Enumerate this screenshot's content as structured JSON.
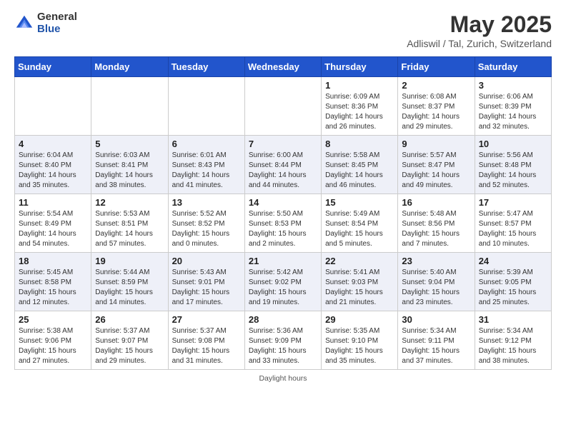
{
  "logo": {
    "general": "General",
    "blue": "Blue"
  },
  "title": "May 2025",
  "subtitle": "Adliswil / Tal, Zurich, Switzerland",
  "days_of_week": [
    "Sunday",
    "Monday",
    "Tuesday",
    "Wednesday",
    "Thursday",
    "Friday",
    "Saturday"
  ],
  "footer": "Daylight hours",
  "weeks": [
    [
      {
        "num": "",
        "info": ""
      },
      {
        "num": "",
        "info": ""
      },
      {
        "num": "",
        "info": ""
      },
      {
        "num": "",
        "info": ""
      },
      {
        "num": "1",
        "info": "Sunrise: 6:09 AM\nSunset: 8:36 PM\nDaylight: 14 hours and 26 minutes."
      },
      {
        "num": "2",
        "info": "Sunrise: 6:08 AM\nSunset: 8:37 PM\nDaylight: 14 hours and 29 minutes."
      },
      {
        "num": "3",
        "info": "Sunrise: 6:06 AM\nSunset: 8:39 PM\nDaylight: 14 hours and 32 minutes."
      }
    ],
    [
      {
        "num": "4",
        "info": "Sunrise: 6:04 AM\nSunset: 8:40 PM\nDaylight: 14 hours and 35 minutes."
      },
      {
        "num": "5",
        "info": "Sunrise: 6:03 AM\nSunset: 8:41 PM\nDaylight: 14 hours and 38 minutes."
      },
      {
        "num": "6",
        "info": "Sunrise: 6:01 AM\nSunset: 8:43 PM\nDaylight: 14 hours and 41 minutes."
      },
      {
        "num": "7",
        "info": "Sunrise: 6:00 AM\nSunset: 8:44 PM\nDaylight: 14 hours and 44 minutes."
      },
      {
        "num": "8",
        "info": "Sunrise: 5:58 AM\nSunset: 8:45 PM\nDaylight: 14 hours and 46 minutes."
      },
      {
        "num": "9",
        "info": "Sunrise: 5:57 AM\nSunset: 8:47 PM\nDaylight: 14 hours and 49 minutes."
      },
      {
        "num": "10",
        "info": "Sunrise: 5:56 AM\nSunset: 8:48 PM\nDaylight: 14 hours and 52 minutes."
      }
    ],
    [
      {
        "num": "11",
        "info": "Sunrise: 5:54 AM\nSunset: 8:49 PM\nDaylight: 14 hours and 54 minutes."
      },
      {
        "num": "12",
        "info": "Sunrise: 5:53 AM\nSunset: 8:51 PM\nDaylight: 14 hours and 57 minutes."
      },
      {
        "num": "13",
        "info": "Sunrise: 5:52 AM\nSunset: 8:52 PM\nDaylight: 15 hours and 0 minutes."
      },
      {
        "num": "14",
        "info": "Sunrise: 5:50 AM\nSunset: 8:53 PM\nDaylight: 15 hours and 2 minutes."
      },
      {
        "num": "15",
        "info": "Sunrise: 5:49 AM\nSunset: 8:54 PM\nDaylight: 15 hours and 5 minutes."
      },
      {
        "num": "16",
        "info": "Sunrise: 5:48 AM\nSunset: 8:56 PM\nDaylight: 15 hours and 7 minutes."
      },
      {
        "num": "17",
        "info": "Sunrise: 5:47 AM\nSunset: 8:57 PM\nDaylight: 15 hours and 10 minutes."
      }
    ],
    [
      {
        "num": "18",
        "info": "Sunrise: 5:45 AM\nSunset: 8:58 PM\nDaylight: 15 hours and 12 minutes."
      },
      {
        "num": "19",
        "info": "Sunrise: 5:44 AM\nSunset: 8:59 PM\nDaylight: 15 hours and 14 minutes."
      },
      {
        "num": "20",
        "info": "Sunrise: 5:43 AM\nSunset: 9:01 PM\nDaylight: 15 hours and 17 minutes."
      },
      {
        "num": "21",
        "info": "Sunrise: 5:42 AM\nSunset: 9:02 PM\nDaylight: 15 hours and 19 minutes."
      },
      {
        "num": "22",
        "info": "Sunrise: 5:41 AM\nSunset: 9:03 PM\nDaylight: 15 hours and 21 minutes."
      },
      {
        "num": "23",
        "info": "Sunrise: 5:40 AM\nSunset: 9:04 PM\nDaylight: 15 hours and 23 minutes."
      },
      {
        "num": "24",
        "info": "Sunrise: 5:39 AM\nSunset: 9:05 PM\nDaylight: 15 hours and 25 minutes."
      }
    ],
    [
      {
        "num": "25",
        "info": "Sunrise: 5:38 AM\nSunset: 9:06 PM\nDaylight: 15 hours and 27 minutes."
      },
      {
        "num": "26",
        "info": "Sunrise: 5:37 AM\nSunset: 9:07 PM\nDaylight: 15 hours and 29 minutes."
      },
      {
        "num": "27",
        "info": "Sunrise: 5:37 AM\nSunset: 9:08 PM\nDaylight: 15 hours and 31 minutes."
      },
      {
        "num": "28",
        "info": "Sunrise: 5:36 AM\nSunset: 9:09 PM\nDaylight: 15 hours and 33 minutes."
      },
      {
        "num": "29",
        "info": "Sunrise: 5:35 AM\nSunset: 9:10 PM\nDaylight: 15 hours and 35 minutes."
      },
      {
        "num": "30",
        "info": "Sunrise: 5:34 AM\nSunset: 9:11 PM\nDaylight: 15 hours and 37 minutes."
      },
      {
        "num": "31",
        "info": "Sunrise: 5:34 AM\nSunset: 9:12 PM\nDaylight: 15 hours and 38 minutes."
      }
    ]
  ]
}
